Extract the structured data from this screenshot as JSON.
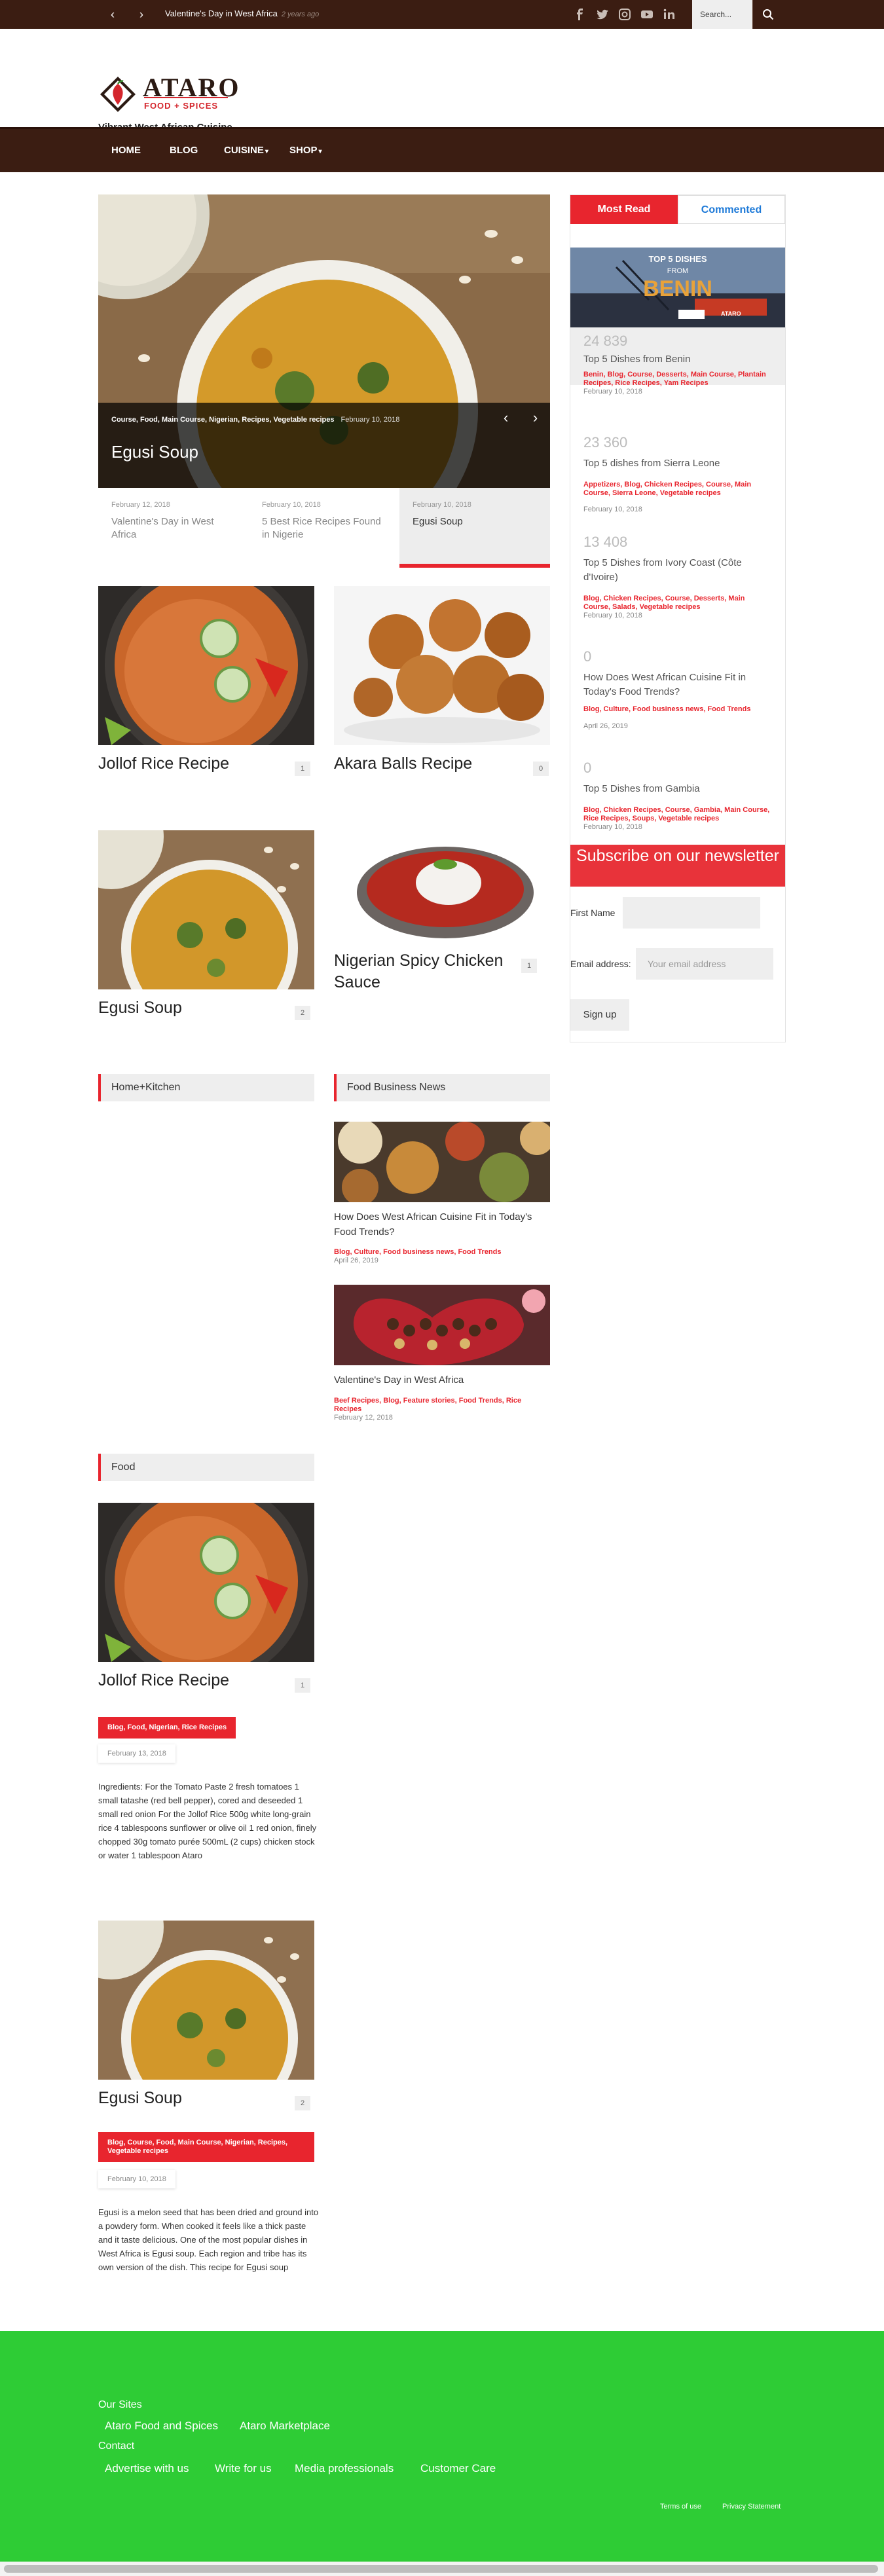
{
  "colors": {
    "brown": "#3b1d12",
    "red": "#e8252e",
    "footer_green": "#2ecc35",
    "blue_tab": "#1e7ad8"
  },
  "topbar": {
    "news_title": "Valentine's Day in West Africa",
    "news_ago": "2 years ago",
    "search_placeholder": "Search...",
    "social_icons": [
      "facebook-icon",
      "twitter-icon",
      "instagram-icon",
      "youtube-icon",
      "linkedin-icon"
    ]
  },
  "header": {
    "logo_name": "ATARO",
    "logo_sub": "FOOD + SPICES",
    "tagline": "Vibrant West African Cuisine"
  },
  "nav": {
    "items": [
      "HOME",
      "BLOG",
      "CUISINE",
      "SHOP"
    ]
  },
  "slider": {
    "tags": "Course, Food, Main Course, Nigerian, Recipes, Vegetable recipes",
    "date": "February 10, 2018",
    "title": "Egusi Soup",
    "tabs": [
      {
        "date": "February 12, 2018",
        "title": "Valentine's Day in West Africa"
      },
      {
        "date": "February 10, 2018",
        "title": "5 Best Rice Recipes Found in Nigerie"
      },
      {
        "date": "February 10, 2018",
        "title": "Egusi Soup"
      }
    ]
  },
  "grid": [
    {
      "title": "Jollof Rice Recipe",
      "count": "1"
    },
    {
      "title": "Akara Balls Recipe",
      "count": "0"
    },
    {
      "title": "Egusi Soup",
      "count": "2"
    },
    {
      "title": "Nigerian Spicy Chicken Sauce",
      "count": "1"
    }
  ],
  "sections": {
    "home_kitchen": "Home+Kitchen",
    "food_business": "Food Business News",
    "food": "Food"
  },
  "food_business_news": [
    {
      "title": "How Does West African Cuisine Fit in Today's Food Trends?",
      "cats": "Blog, Culture, Food business news, Food Trends",
      "date": "April 26, 2019"
    },
    {
      "title": "Valentine's Day in West Africa",
      "cats": "Beef Recipes, Blog, Feature stories, Food Trends, Rice Recipes",
      "date": "February 12, 2018"
    }
  ],
  "food_posts": [
    {
      "title": "Jollof Rice Recipe",
      "count": "1",
      "cats": "Blog, Food, Nigerian, Rice Recipes",
      "date": "February 13, 2018",
      "excerpt": "Ingredients: For the Tomato Paste 2 fresh tomatoes 1 small tatashe (red bell pepper), cored and deseeded 1 small red onion   For the Jollof Rice 500g white long-grain rice 4 tablespoons sunflower or olive oil 1 red onion, finely chopped 30g tomato purée 500mL (2 cups) chicken stock or water 1 tablespoon Ataro"
    },
    {
      "title": "Egusi Soup",
      "count": "2",
      "cats": "Blog, Course, Food, Main Course, Nigerian, Recipes, Vegetable recipes",
      "date": "February 10, 2018",
      "excerpt": "Egusi is a melon seed that has been dried and ground into a powdery form. When cooked it feels like a thick paste and it taste delicious. One of the most popular dishes in West Africa is Egusi soup. Each region and tribe has its own version of the dish. This recipe for Egusi soup"
    }
  ],
  "sidebar": {
    "tab_most_read": "Most Read",
    "tab_commented": "Commented",
    "banner_line1": "TOP 5 DISHES",
    "banner_line2": "FROM",
    "banner_line3": "BENIN",
    "banner_brand": "ATARO",
    "items": [
      {
        "count": "24 839",
        "title": "Top 5 Dishes from Benin",
        "cats": "Benin, Blog, Course, Desserts, Main Course, Plantain Recipes, Rice Recipes, Yam Recipes",
        "date": "February 10, 2018"
      },
      {
        "count": "23 360",
        "title": "Top 5 dishes from Sierra Leone",
        "cats": "Appetizers, Blog, Chicken Recipes, Course, Main Course, Sierra Leone, Vegetable recipes",
        "date": "February 10, 2018"
      },
      {
        "count": "13 408",
        "title": "Top 5 Dishes from Ivory Coast (Côte d'Ivoire)",
        "cats": "Blog, Chicken Recipes, Course, Desserts, Main Course, Salads, Vegetable recipes",
        "date": "February 10, 2018"
      },
      {
        "count": "0",
        "title": "How Does West African Cuisine Fit in Today's Food Trends?",
        "cats": "Blog, Culture, Food business news, Food Trends",
        "date": "April 26, 2019"
      },
      {
        "count": "0",
        "title": "Top 5 Dishes from Gambia",
        "cats": "Blog, Chicken Recipes, Course, Gambia, Main Course, Rice Recipes, Soups, Vegetable recipes",
        "date": "February 10, 2018"
      }
    ],
    "subscribe_title": "Subscribe on our newsletter",
    "first_name_label": "First Name",
    "email_label": "Email address:",
    "email_placeholder": "Your email address",
    "signup_label": "Sign up"
  },
  "footer": {
    "our_sites": "Our Sites",
    "site_links": [
      "Ataro Food and Spices",
      "Ataro Marketplace"
    ],
    "contact": "Contact",
    "contact_links": [
      "Advertise with us",
      "Write for us",
      "Media professionals",
      "Customer Care"
    ],
    "terms": "Terms of use",
    "privacy": "Privacy Statement"
  }
}
